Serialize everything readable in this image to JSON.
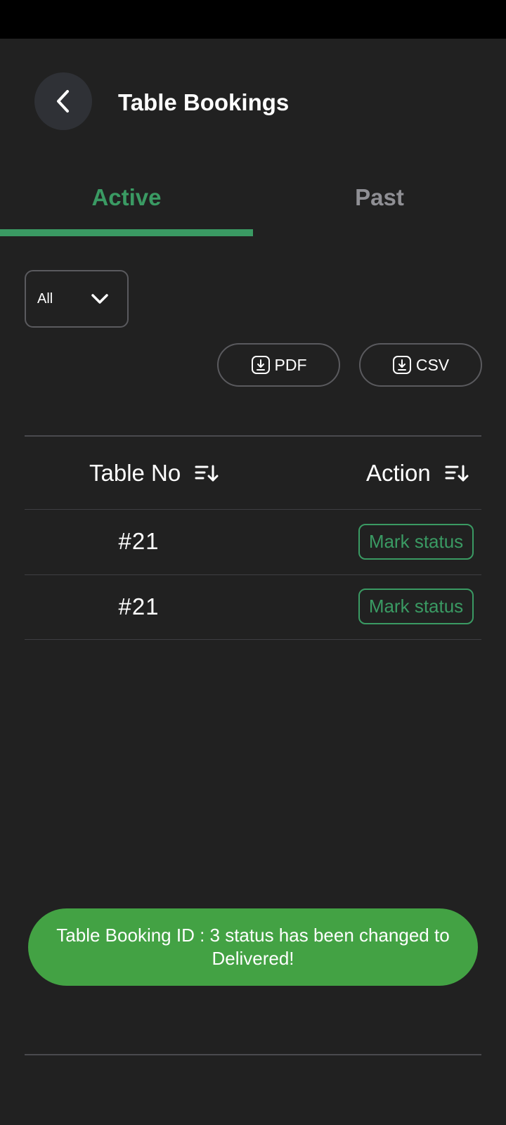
{
  "header": {
    "title": "Table Bookings",
    "back_icon": "chevron-left-icon"
  },
  "tabs": [
    {
      "label": "Active",
      "active": true
    },
    {
      "label": "Past",
      "active": false
    }
  ],
  "filter": {
    "selected": "All",
    "icon": "chevron-down-icon"
  },
  "export": {
    "pdf_label": "PDF",
    "csv_label": "CSV",
    "icon": "download-icon"
  },
  "table": {
    "columns": [
      {
        "label": "Table No",
        "icon": "sort-icon"
      },
      {
        "label": "Action",
        "icon": "sort-icon"
      }
    ],
    "rows": [
      {
        "table_no": "#21",
        "action": "Mark status"
      },
      {
        "table_no": "#21",
        "action": "Mark status"
      }
    ]
  },
  "toast": {
    "message": "Table Booking ID : 3 status has been changed to Delivered!"
  },
  "colors": {
    "accent": "#3a9a63",
    "background": "#212121",
    "toast": "#43a244",
    "muted": "#8f8f94"
  }
}
